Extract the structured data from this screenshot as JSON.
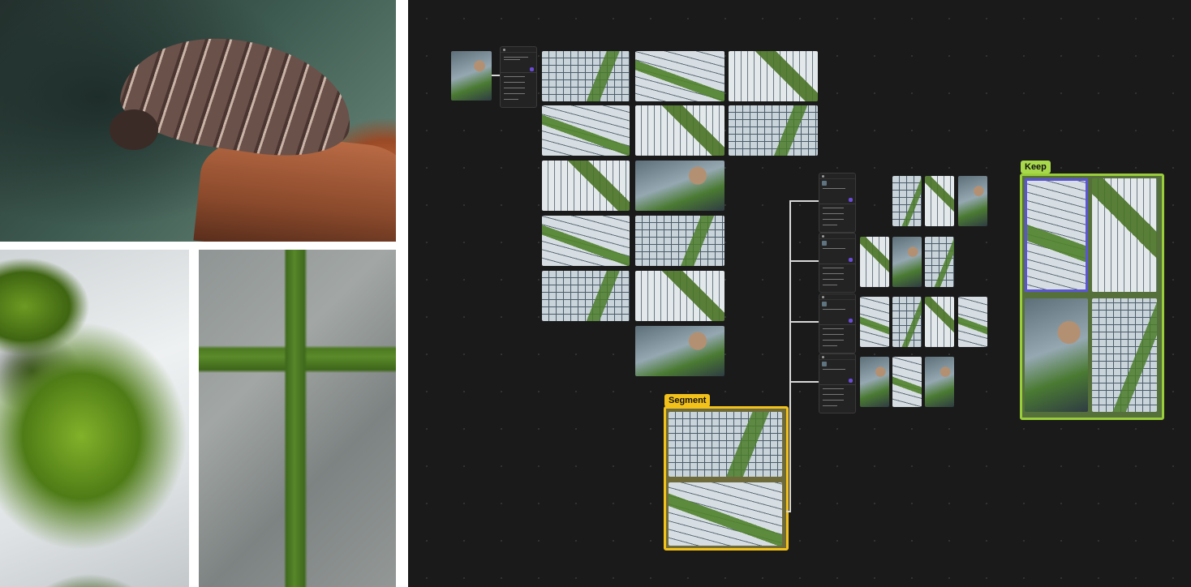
{
  "reference_images": [
    {
      "subject": "isopod"
    },
    {
      "subject": "moss-and-snow"
    },
    {
      "subject": "moss-between-stones"
    }
  ],
  "canvas": {
    "background": "#1a1a1a",
    "group_segment": {
      "label": "Segment",
      "color": "#f2c21b"
    },
    "group_keep": {
      "label": "Keep",
      "color": "#a8d94a"
    },
    "selection_color": "#5b55d6",
    "node_send_color": "#6a4bd6",
    "modify_node_icon": "magic-wand-icon",
    "send_icon": "arrow-up-icon"
  }
}
